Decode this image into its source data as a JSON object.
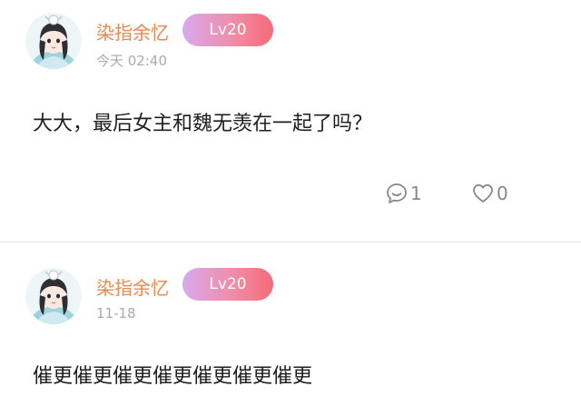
{
  "posts": [
    {
      "username": "染指余忆",
      "level": "Lv20",
      "timestamp": "今天 02:40",
      "content": "大大，最后女主和魏无羡在一起了吗？",
      "comment_count": "1",
      "like_count": "0"
    },
    {
      "username": "染指余忆",
      "level": "Lv20",
      "timestamp": "11-18",
      "content": "催更催更催更催更催更催更催更"
    }
  ],
  "colors": {
    "username": "#e8894d",
    "badge_start": "#d9a9ee",
    "badge_end": "#f56b77",
    "timestamp": "#aaaaaa",
    "action": "#888888",
    "divider": "#e3e3e3"
  },
  "icons": {
    "comment": "comment-bubble-icon",
    "like": "heart-outline-icon"
  }
}
